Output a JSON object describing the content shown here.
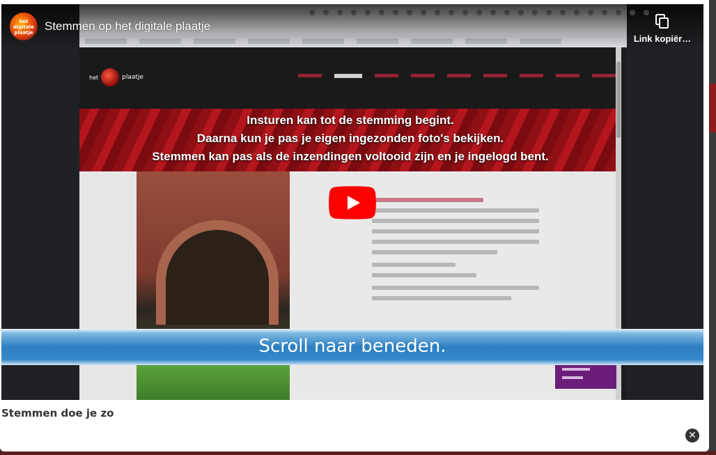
{
  "video": {
    "channel_icon": "channel-avatar",
    "channel_avatar_text": "het digitale plaatje",
    "title": "Stemmen op het digitale plaatje",
    "copy_link_label": "Link kopiër…",
    "copy_icon": "copy-icon",
    "play_icon": "youtube-play-icon",
    "caption": "Scroll naar beneden."
  },
  "screencast": {
    "site_logo_text": "plaatje",
    "banner_lines": [
      "Insturen kan tot de stemming begint.",
      "Daarna kun je pas je eigen ingezonden foto's bekijken.",
      "Stemmen kan pas als de inzendingen voltooid zijn en je ingelogd bent."
    ]
  },
  "modal": {
    "caption": "Stemmen doe je zo",
    "close_icon": "close-icon"
  },
  "colors": {
    "youtube_red": "#ff0000",
    "banner_red": "#a3121a",
    "caption_blue": "#2d7fc2"
  }
}
